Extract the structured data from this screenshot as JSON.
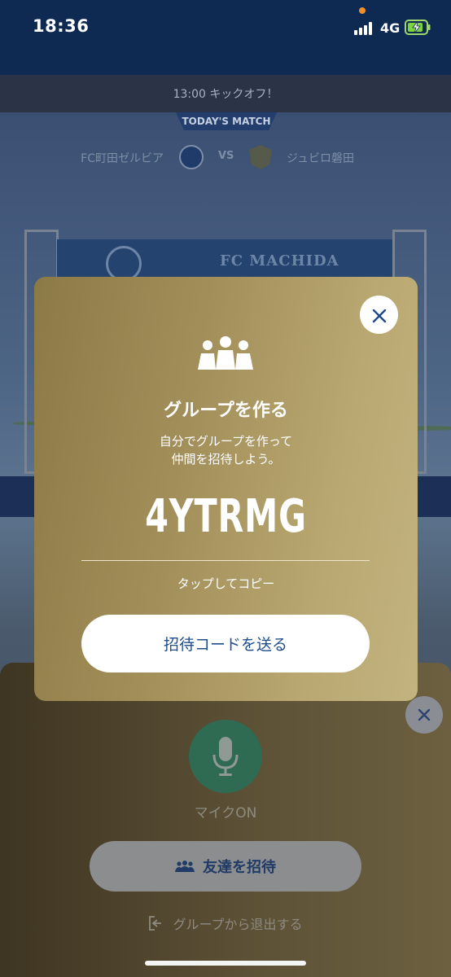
{
  "status_bar": {
    "time": "18:36",
    "network": "4G"
  },
  "match": {
    "kickoff_text": "13:00 キックオフ！",
    "today_label": "TODAY'S MATCH",
    "home_team": "FC町田ゼルビア",
    "vs_label": "VS",
    "away_team": "ジュビロ磐田",
    "banner_text": "FC MACHIDA"
  },
  "modal": {
    "title": "グループを作る",
    "description_line1": "自分でグループを作って",
    "description_line2": "仲間を招待しよう。",
    "invite_code": "4YTRMG",
    "copy_hint": "タップしてコピー",
    "send_button": "招待コードを送る"
  },
  "group_sheet": {
    "mic_label": "マイクON",
    "invite_button": "友達を招待",
    "leave_label": "グループから退出する"
  },
  "colors": {
    "navy": "#0f2a52",
    "modal_gold": "#b9a871",
    "accent_blue": "#1f4d8a",
    "mic_green": "#2f6a52"
  },
  "icons": [
    "group-icon",
    "close-icon",
    "mic-icon",
    "people-icon",
    "exit-icon",
    "signal-icon",
    "battery-charging-icon"
  ]
}
